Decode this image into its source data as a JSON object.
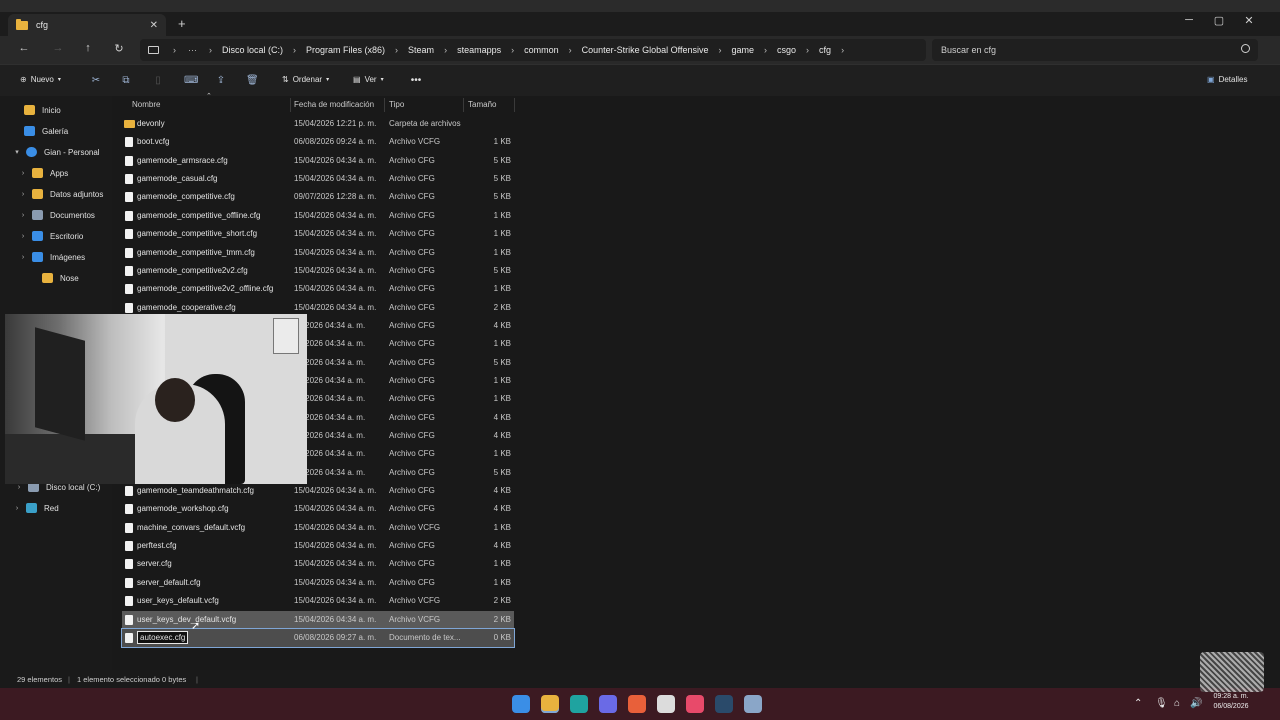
{
  "window": {
    "tab_title": "cfg"
  },
  "address": {
    "crumbs": [
      "Disco local (C:)",
      "Program Files (x86)",
      "Steam",
      "steamapps",
      "common",
      "Counter-Strike Global Offensive",
      "game",
      "csgo",
      "cfg"
    ],
    "search_placeholder": "Buscar en cfg"
  },
  "toolbar": {
    "new": "Nuevo",
    "sort": "Ordenar",
    "view": "Ver",
    "details": "Detalles"
  },
  "sidebar": {
    "items": [
      {
        "label": "Inicio",
        "icon": "home-icon",
        "color": "#e8b23e"
      },
      {
        "label": "Galería",
        "icon": "gallery-icon",
        "color": "#3a8ee6"
      },
      {
        "label": "Gian - Personal",
        "icon": "cloud-icon",
        "color": "#3a8ee6"
      },
      {
        "label": "Apps",
        "icon": "folder-icon",
        "color": "#e8b23e"
      },
      {
        "label": "Datos adjuntos",
        "icon": "folder-icon",
        "color": "#e8b23e"
      },
      {
        "label": "Documentos",
        "icon": "documents-icon",
        "color": "#8a9bb0"
      },
      {
        "label": "Escritorio",
        "icon": "desktop-icon",
        "color": "#3a8ee6"
      },
      {
        "label": "Imágenes",
        "icon": "pictures-icon",
        "color": "#3a8ee6"
      },
      {
        "label": "Nose",
        "icon": "folder-icon",
        "color": "#e8b23e"
      },
      {
        "label": "Disco local (C:)",
        "icon": "drive-icon",
        "color": "#8a9bb0"
      },
      {
        "label": "Red",
        "icon": "network-icon",
        "color": "#3aa0c8"
      }
    ]
  },
  "columns": {
    "name": "Nombre",
    "date": "Fecha de modificación",
    "type": "Tipo",
    "size": "Tamaño"
  },
  "files": [
    {
      "name": "devonly",
      "date": "15/04/2026 12:21 p. m.",
      "type": "Carpeta de archivos",
      "size": "",
      "kind": "folder"
    },
    {
      "name": "boot.vcfg",
      "date": "06/08/2026 09:24 a. m.",
      "type": "Archivo VCFG",
      "size": "1 KB",
      "kind": "file"
    },
    {
      "name": "gamemode_armsrace.cfg",
      "date": "15/04/2026 04:34 a. m.",
      "type": "Archivo CFG",
      "size": "5 KB",
      "kind": "file"
    },
    {
      "name": "gamemode_casual.cfg",
      "date": "15/04/2026 04:34 a. m.",
      "type": "Archivo CFG",
      "size": "5 KB",
      "kind": "file"
    },
    {
      "name": "gamemode_competitive.cfg",
      "date": "09/07/2026 12:28 a. m.",
      "type": "Archivo CFG",
      "size": "5 KB",
      "kind": "file"
    },
    {
      "name": "gamemode_competitive_offline.cfg",
      "date": "15/04/2026 04:34 a. m.",
      "type": "Archivo CFG",
      "size": "1 KB",
      "kind": "file"
    },
    {
      "name": "gamemode_competitive_short.cfg",
      "date": "15/04/2026 04:34 a. m.",
      "type": "Archivo CFG",
      "size": "1 KB",
      "kind": "file"
    },
    {
      "name": "gamemode_competitive_tmm.cfg",
      "date": "15/04/2026 04:34 a. m.",
      "type": "Archivo CFG",
      "size": "1 KB",
      "kind": "file"
    },
    {
      "name": "gamemode_competitive2v2.cfg",
      "date": "15/04/2026 04:34 a. m.",
      "type": "Archivo CFG",
      "size": "5 KB",
      "kind": "file"
    },
    {
      "name": "gamemode_competitive2v2_offline.cfg",
      "date": "15/04/2026 04:34 a. m.",
      "type": "Archivo CFG",
      "size": "1 KB",
      "kind": "file"
    },
    {
      "name": "gamemode_cooperative.cfg",
      "date": "15/04/2026 04:34 a. m.",
      "type": "Archivo CFG",
      "size": "2 KB",
      "kind": "file"
    },
    {
      "name": "",
      "date": "04/2026 04:34 a. m.",
      "type": "Archivo CFG",
      "size": "4 KB",
      "kind": "file"
    },
    {
      "name": "",
      "date": "04/2026 04:34 a. m.",
      "type": "Archivo CFG",
      "size": "1 KB",
      "kind": "file"
    },
    {
      "name": "",
      "date": "04/2026 04:34 a. m.",
      "type": "Archivo CFG",
      "size": "5 KB",
      "kind": "file"
    },
    {
      "name": "",
      "date": "04/2026 04:34 a. m.",
      "type": "Archivo CFG",
      "size": "1 KB",
      "kind": "file"
    },
    {
      "name": "",
      "date": "04/2026 04:34 a. m.",
      "type": "Archivo CFG",
      "size": "1 KB",
      "kind": "file"
    },
    {
      "name": "",
      "date": "04/2026 04:34 a. m.",
      "type": "Archivo CFG",
      "size": "4 KB",
      "kind": "file"
    },
    {
      "name": "",
      "date": "04/2026 04:34 a. m.",
      "type": "Archivo CFG",
      "size": "4 KB",
      "kind": "file"
    },
    {
      "name": "",
      "date": "04/2026 04:34 a. m.",
      "type": "Archivo CFG",
      "size": "1 KB",
      "kind": "file"
    },
    {
      "name": "",
      "date": "04/2026 04:34 a. m.",
      "type": "Archivo CFG",
      "size": "5 KB",
      "kind": "file"
    },
    {
      "name": "gamemode_teamdeathmatch.cfg",
      "date": "15/04/2026 04:34 a. m.",
      "type": "Archivo CFG",
      "size": "4 KB",
      "kind": "file"
    },
    {
      "name": "gamemode_workshop.cfg",
      "date": "15/04/2026 04:34 a. m.",
      "type": "Archivo CFG",
      "size": "4 KB",
      "kind": "file"
    },
    {
      "name": "machine_convars_default.vcfg",
      "date": "15/04/2026 04:34 a. m.",
      "type": "Archivo VCFG",
      "size": "1 KB",
      "kind": "file"
    },
    {
      "name": "perftest.cfg",
      "date": "15/04/2026 04:34 a. m.",
      "type": "Archivo CFG",
      "size": "4 KB",
      "kind": "file"
    },
    {
      "name": "server.cfg",
      "date": "15/04/2026 04:34 a. m.",
      "type": "Archivo CFG",
      "size": "1 KB",
      "kind": "file"
    },
    {
      "name": "server_default.cfg",
      "date": "15/04/2026 04:34 a. m.",
      "type": "Archivo CFG",
      "size": "1 KB",
      "kind": "file"
    },
    {
      "name": "user_keys_default.vcfg",
      "date": "15/04/2026 04:34 a. m.",
      "type": "Archivo VCFG",
      "size": "2 KB",
      "kind": "file"
    },
    {
      "name": "user_keys_dev_default.vcfg",
      "date": "15/04/2026 04:34 a. m.",
      "type": "Archivo VCFG",
      "size": "2 KB",
      "kind": "file",
      "state": "selected"
    },
    {
      "name": "autoexec.cfg",
      "date": "06/08/2026 09:27 a. m.",
      "type": "Documento de tex...",
      "size": "0 KB",
      "kind": "file",
      "state": "editing"
    }
  ],
  "status": {
    "count": "29 elementos",
    "selection": "1 elemento seleccionado 0 bytes"
  },
  "taskbar": {
    "apps": [
      {
        "name": "start-icon",
        "color": "#3a8ee6"
      },
      {
        "name": "file-explorer-icon",
        "color": "#e8b23e"
      },
      {
        "name": "edge-icon",
        "color": "#1fa3a0"
      },
      {
        "name": "discord-icon",
        "color": "#6a6ae6"
      },
      {
        "name": "app-orange-icon",
        "color": "#e8603a"
      },
      {
        "name": "chatgpt-icon",
        "color": "#dcdcdc"
      },
      {
        "name": "music-icon",
        "color": "#e84a6a"
      },
      {
        "name": "steam-icon",
        "color": "#2a4a6a"
      },
      {
        "name": "settings-icon",
        "color": "#8aa6c8"
      }
    ],
    "clock_time": "09:28 a. m.",
    "clock_date": "06/08/2026"
  }
}
